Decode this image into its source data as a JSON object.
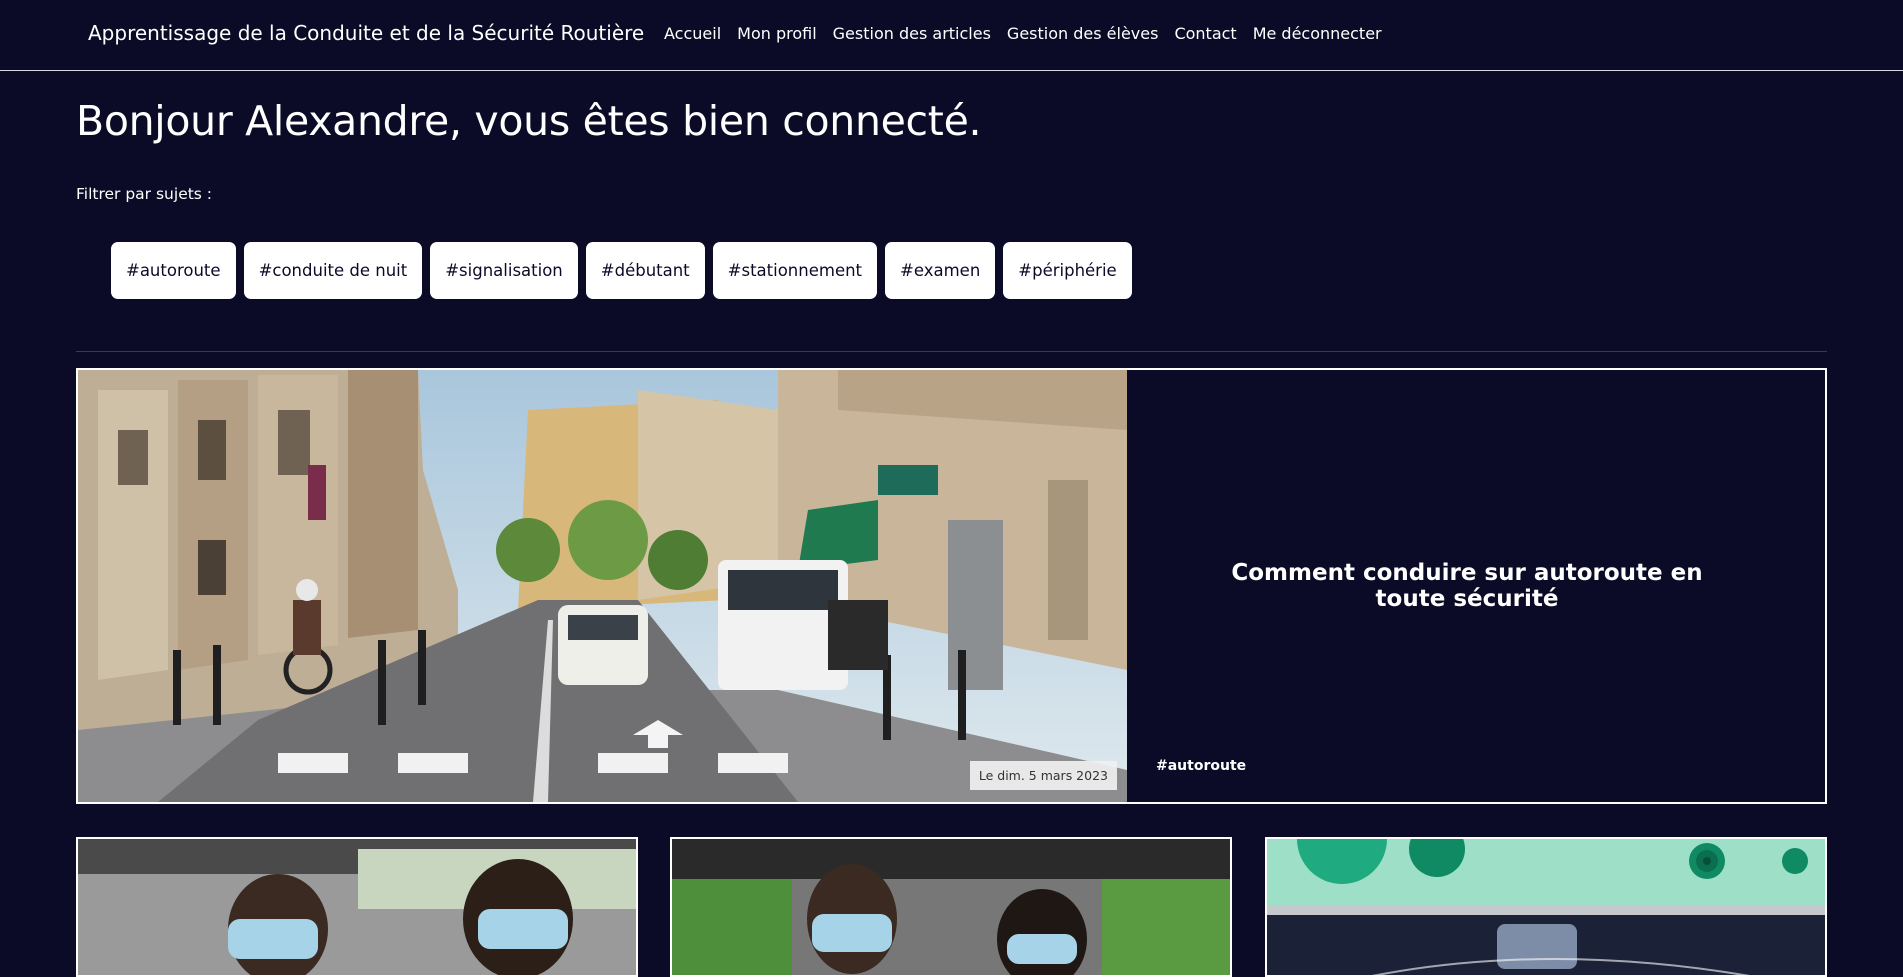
{
  "navbar": {
    "brand": "Apprentissage de la Conduite et de la Sécurité Routière",
    "links": [
      "Accueil",
      "Mon profil",
      "Gestion des articles",
      "Gestion des élèves",
      "Contact",
      "Me déconnecter"
    ]
  },
  "page": {
    "greeting": "Bonjour Alexandre, vous êtes bien connecté.",
    "filter_label": "Filtrer par sujets :"
  },
  "tags": [
    "#autoroute",
    "#conduite de nuit",
    "#signalisation",
    "#débutant",
    "#stationnement",
    "#examen",
    "#périphérie"
  ],
  "featured": {
    "title": "Comment conduire sur autoroute en toute sécurité",
    "date": "Le dim. 5 mars 2023",
    "tag": "#autoroute",
    "image": "street-photo"
  },
  "cards": [
    {
      "image": "masked-driving-lesson-photo"
    },
    {
      "image": "masked-driver-passenger-photo"
    },
    {
      "image": "parking-illustration"
    }
  ],
  "colors": {
    "background": "#0b0b27",
    "text": "#ffffff",
    "tag_bg": "#ffffff",
    "tag_text": "#0b0b27"
  }
}
